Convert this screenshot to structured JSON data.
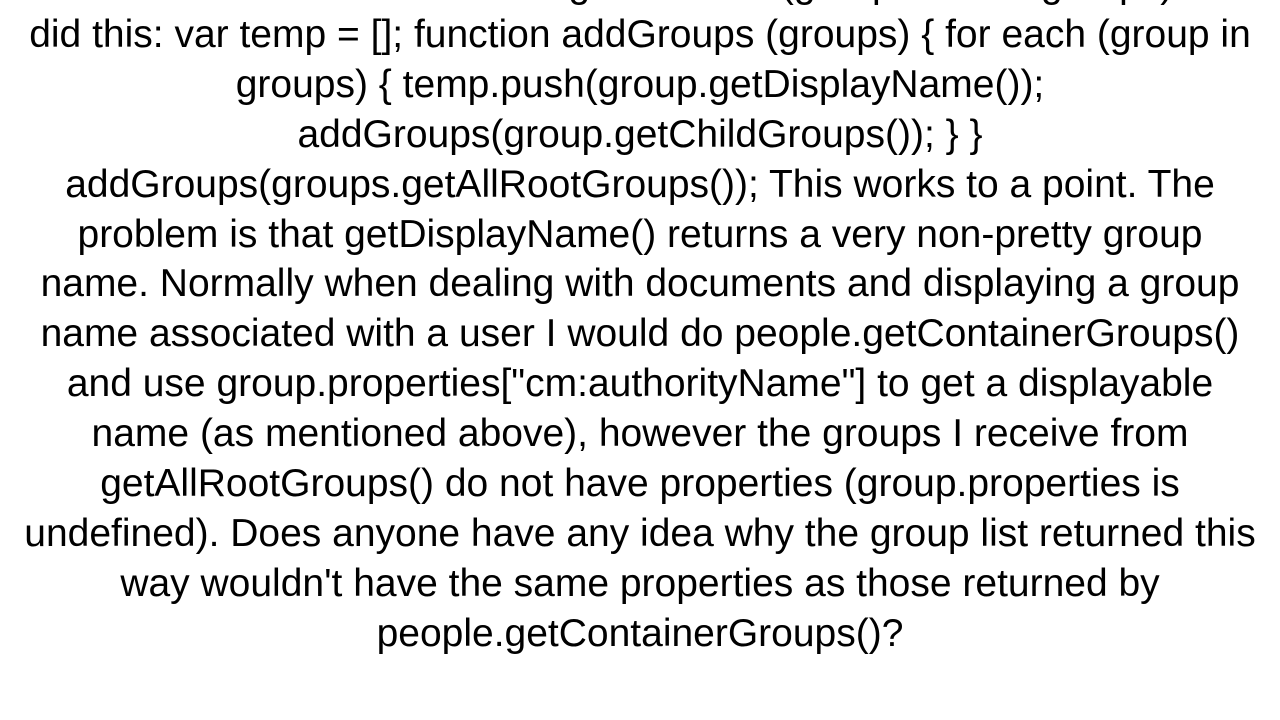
{
  "document": {
    "body_text": "I needed a recursive search to get them all (group/subsub groups) so I did this: var temp = [];  function addGroups (groups)   {     for each (group in groups)       {         temp.push(group.getDisplayName());         addGroups(group.getChildGroups());       }   }   addGroups(groups.getAllRootGroups());  This works to a point.  The problem is that getDisplayName() returns a very non-pretty group name.  Normally when dealing with documents and displaying a group name associated with a user I would do people.getContainerGroups() and use group.properties[\"cm:authorityName\"] to get a displayable name (as mentioned above), however the groups I receive from getAllRootGroups() do not have properties (group.properties is undefined). Does anyone have any idea why the group list returned this way wouldn't have the same properties as those returned by people.getContainerGroups()?"
  }
}
